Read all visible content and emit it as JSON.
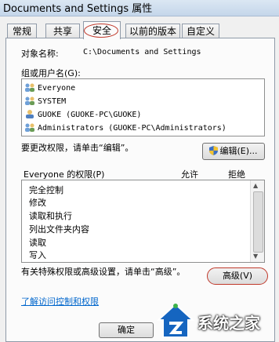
{
  "window": {
    "title": "Documents and Settings 属性"
  },
  "tabs": [
    {
      "label": "常规"
    },
    {
      "label": "共享"
    },
    {
      "label": "安全"
    },
    {
      "label": "以前的版本"
    },
    {
      "label": "自定义"
    }
  ],
  "object": {
    "label": "对象名称:",
    "value": "C:\\Documents and Settings"
  },
  "groups": {
    "label": "组或用户名(G):",
    "items": [
      {
        "name": "Everyone",
        "icon": "group-icon"
      },
      {
        "name": "SYSTEM",
        "icon": "group-icon"
      },
      {
        "name": "GUOKE (GUOKE-PC\\GUOKE)",
        "icon": "user-icon"
      },
      {
        "name": "Administrators (GUOKE-PC\\Administrators)",
        "icon": "group-icon"
      }
    ]
  },
  "edit": {
    "hint": "要更改权限，请单击“编辑”。",
    "button": "编辑(E)..."
  },
  "permissions": {
    "title": "Everyone 的权限(P)",
    "allow": "允许",
    "deny": "拒绝",
    "rows": [
      {
        "label": "完全控制"
      },
      {
        "label": "修改"
      },
      {
        "label": "读取和执行"
      },
      {
        "label": "列出文件夹内容"
      },
      {
        "label": "读取"
      },
      {
        "label": "写入"
      }
    ]
  },
  "advanced": {
    "hint": "有关特殊权限或高级设置，请单击“高级”。",
    "button": "高级(V)"
  },
  "link": {
    "text": "了解访问控制和权限"
  },
  "footer": {
    "ok": "确定"
  },
  "watermark": {
    "text": "系统之家"
  },
  "colors": {
    "annotation_red": "#c0392b",
    "link_blue": "#0066cc",
    "logo_blue": "#1565c0"
  }
}
